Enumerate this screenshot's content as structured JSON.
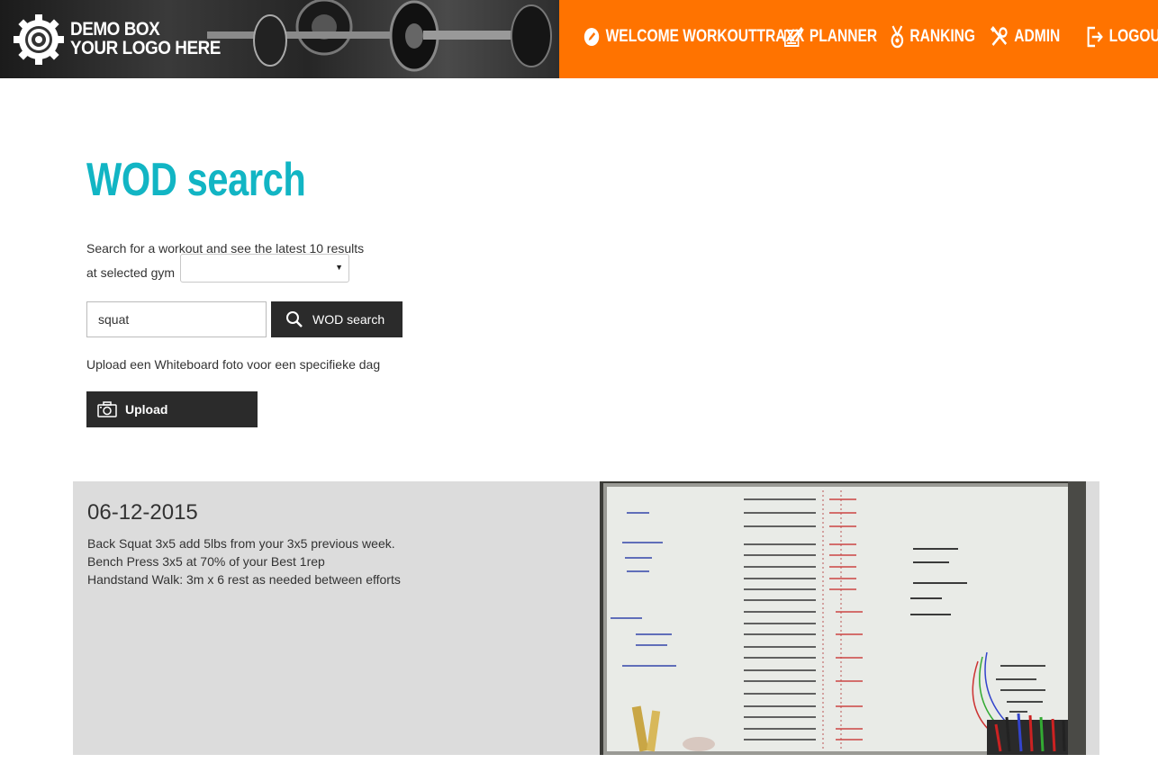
{
  "header": {
    "logo_line1": "DEMO BOX",
    "logo_line2": "YOUR LOGO HERE",
    "nav": [
      {
        "label": "WELCOME WORKOUTTRAXX",
        "icon": "pencil-icon"
      },
      {
        "label": "PLANNER",
        "icon": "checklist-icon"
      },
      {
        "label": "RANKING",
        "icon": "medal-icon"
      },
      {
        "label": "ADMIN",
        "icon": "tools-icon"
      },
      {
        "label": "LOGOUT",
        "icon": "logout-icon"
      }
    ],
    "colors": {
      "nav_bg": "#ff7300",
      "title": "#12b5c4"
    }
  },
  "main": {
    "title": "WOD search",
    "intro_line1": "Search for a workout and see the latest 10 results",
    "intro_line2": "at selected gym",
    "gym_select_value": "",
    "search_value": "squat",
    "search_button": "WOD search",
    "upload_text": "Upload een Whiteboard foto voor een specifieke dag",
    "upload_button": "Upload"
  },
  "result": {
    "date": "06-12-2015",
    "lines": [
      "Back Squat 3x5 add 5lbs from your 3x5 previous week.",
      "Bench Press 3x5 at 70% of your Best 1rep",
      "Handstand Walk: 3m x 6 rest as needed between efforts"
    ]
  }
}
